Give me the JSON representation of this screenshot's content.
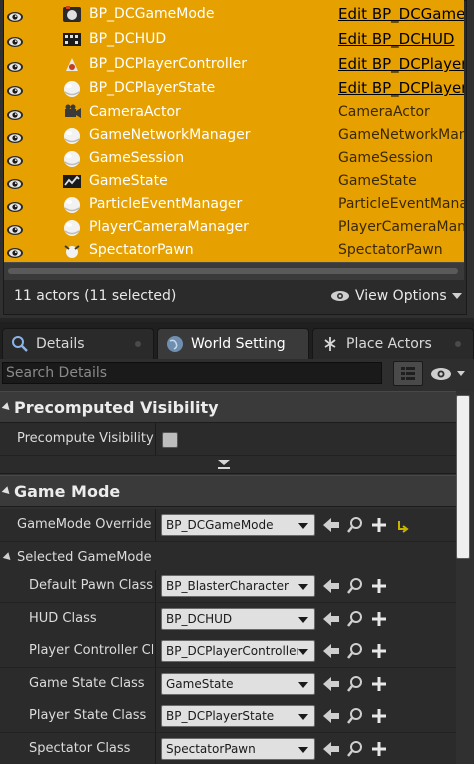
{
  "outliner": {
    "rows": [
      {
        "label": "BP_DCGameMode",
        "type": "Edit BP_DCGameMode",
        "link": true,
        "icon": "gamemode-icon"
      },
      {
        "label": "BP_DCHUD",
        "type": "Edit BP_DCHUD",
        "link": true,
        "icon": "hud-icon"
      },
      {
        "label": "BP_DCPlayerController",
        "type": "Edit BP_DCPlayerController",
        "link": true,
        "icon": "controller-icon"
      },
      {
        "label": "BP_DCPlayerState",
        "type": "Edit BP_DCPlayerState",
        "link": true,
        "icon": "sphere-icon"
      },
      {
        "label": "CameraActor",
        "type": "CameraActor",
        "link": false,
        "icon": "camera-icon"
      },
      {
        "label": "GameNetworkManager",
        "type": "GameNetworkManager",
        "link": false,
        "icon": "sphere-icon"
      },
      {
        "label": "GameSession",
        "type": "GameSession",
        "link": false,
        "icon": "sphere-icon"
      },
      {
        "label": "GameState",
        "type": "GameState",
        "link": false,
        "icon": "gamestate-icon"
      },
      {
        "label": "ParticleEventManager",
        "type": "ParticleEventManager",
        "link": false,
        "icon": "sphere-icon"
      },
      {
        "label": "PlayerCameraManager",
        "type": "PlayerCameraManager",
        "link": false,
        "icon": "sphere-icon"
      },
      {
        "label": "SpectatorPawn",
        "type": "SpectatorPawn",
        "link": false,
        "icon": "pawn-icon"
      }
    ],
    "status": "11 actors (11 selected)",
    "view_options": "View Options"
  },
  "tabs": [
    {
      "label": "Details",
      "icon": "details-icon"
    },
    {
      "label": "World Setting",
      "icon": "world-icon"
    },
    {
      "label": "Place Actors",
      "icon": "place-actors-icon"
    }
  ],
  "details": {
    "search_placeholder": "Search Details",
    "sections": {
      "precomputed": {
        "title": "Precomputed Visibility",
        "precompute_label": "Precompute Visibility",
        "precompute_checked": false
      },
      "gamemode": {
        "title": "Game Mode",
        "override_label": "GameMode Override",
        "override_value": "BP_DCGameMode",
        "selected_label": "Selected GameMode",
        "props": [
          {
            "label": "Default Pawn Class",
            "value": "BP_BlasterCharacter"
          },
          {
            "label": "HUD Class",
            "value": "BP_DCHUD"
          },
          {
            "label": "Player Controller Clas",
            "value": "BP_DCPlayerController"
          },
          {
            "label": "Game State Class",
            "value": "GameState"
          },
          {
            "label": "Player State Class",
            "value": "BP_DCPlayerState"
          },
          {
            "label": "Spectator Class",
            "value": "SpectatorPawn"
          }
        ]
      }
    }
  },
  "colors": {
    "selection": "#e6a100",
    "panel": "#303030",
    "header": "#3a3a3a"
  }
}
